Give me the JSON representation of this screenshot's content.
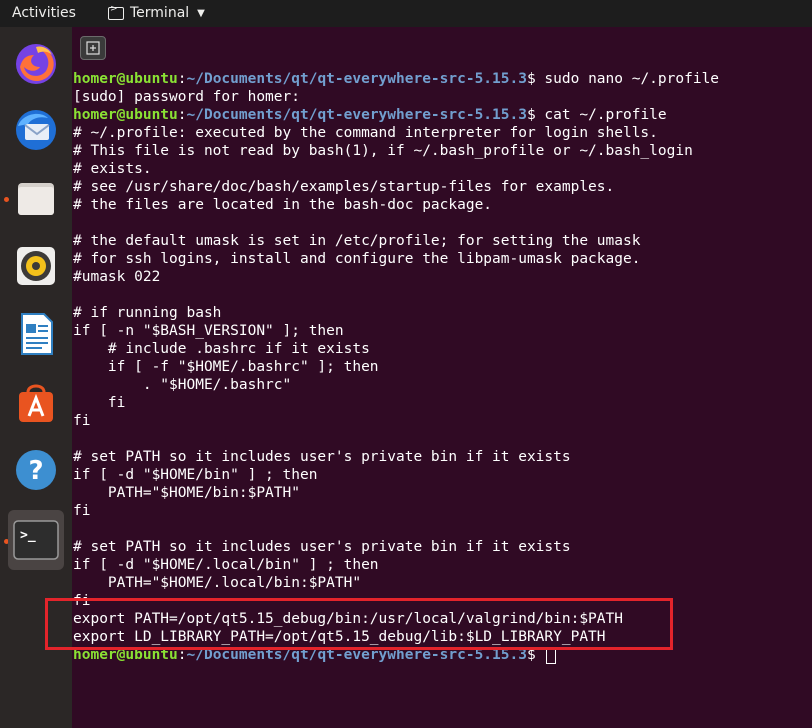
{
  "topbar": {
    "activities_label": "Activities",
    "app_name": "Terminal"
  },
  "dock": {
    "items": [
      {
        "name": "firefox",
        "running": false
      },
      {
        "name": "thunderbird",
        "running": false
      },
      {
        "name": "files",
        "running": true
      },
      {
        "name": "rhythmbox",
        "running": false
      },
      {
        "name": "libreoffice-writer",
        "running": false
      },
      {
        "name": "ubuntu-software",
        "running": false
      },
      {
        "name": "help",
        "running": false
      },
      {
        "name": "terminal",
        "running": true,
        "active": true
      }
    ]
  },
  "colors": {
    "terminal_bg": "#300a24",
    "prompt_user": "#8ae234",
    "prompt_path": "#729fcf",
    "highlight": "#e3242b",
    "running_dot": "#e95420"
  },
  "terminal": {
    "prompt": {
      "user": "homer@ubuntu",
      "path": "~/Documents/qt/qt-everywhere-src-5.15.3"
    },
    "lines": [
      {
        "kind": "cmd",
        "cmd": "sudo nano ~/.profile"
      },
      {
        "kind": "text",
        "text": "[sudo] password for homer:"
      },
      {
        "kind": "cmd",
        "cmd": "cat ~/.profile"
      },
      {
        "kind": "text",
        "text": "# ~/.profile: executed by the command interpreter for login shells."
      },
      {
        "kind": "text",
        "text": "# This file is not read by bash(1), if ~/.bash_profile or ~/.bash_login"
      },
      {
        "kind": "text",
        "text": "# exists."
      },
      {
        "kind": "text",
        "text": "# see /usr/share/doc/bash/examples/startup-files for examples."
      },
      {
        "kind": "text",
        "text": "# the files are located in the bash-doc package."
      },
      {
        "kind": "text",
        "text": ""
      },
      {
        "kind": "text",
        "text": "# the default umask is set in /etc/profile; for setting the umask"
      },
      {
        "kind": "text",
        "text": "# for ssh logins, install and configure the libpam-umask package."
      },
      {
        "kind": "text",
        "text": "#umask 022"
      },
      {
        "kind": "text",
        "text": ""
      },
      {
        "kind": "text",
        "text": "# if running bash"
      },
      {
        "kind": "text",
        "text": "if [ -n \"$BASH_VERSION\" ]; then"
      },
      {
        "kind": "text",
        "text": "    # include .bashrc if it exists"
      },
      {
        "kind": "text",
        "text": "    if [ -f \"$HOME/.bashrc\" ]; then"
      },
      {
        "kind": "text",
        "text": "        . \"$HOME/.bashrc\""
      },
      {
        "kind": "text",
        "text": "    fi"
      },
      {
        "kind": "text",
        "text": "fi"
      },
      {
        "kind": "text",
        "text": ""
      },
      {
        "kind": "text",
        "text": "# set PATH so it includes user's private bin if it exists"
      },
      {
        "kind": "text",
        "text": "if [ -d \"$HOME/bin\" ] ; then"
      },
      {
        "kind": "text",
        "text": "    PATH=\"$HOME/bin:$PATH\""
      },
      {
        "kind": "text",
        "text": "fi"
      },
      {
        "kind": "text",
        "text": ""
      },
      {
        "kind": "text",
        "text": "# set PATH so it includes user's private bin if it exists"
      },
      {
        "kind": "text",
        "text": "if [ -d \"$HOME/.local/bin\" ] ; then"
      },
      {
        "kind": "text",
        "text": "    PATH=\"$HOME/.local/bin:$PATH\""
      },
      {
        "kind": "text",
        "text": "fi"
      },
      {
        "kind": "text",
        "text": "export PATH=/opt/qt5.15_debug/bin:/usr/local/valgrind/bin:$PATH"
      },
      {
        "kind": "text",
        "text": "export LD_LIBRARY_PATH=/opt/qt5.15_debug/lib:$LD_LIBRARY_PATH"
      },
      {
        "kind": "cmd",
        "cmd": "",
        "cursor": true
      }
    ]
  }
}
